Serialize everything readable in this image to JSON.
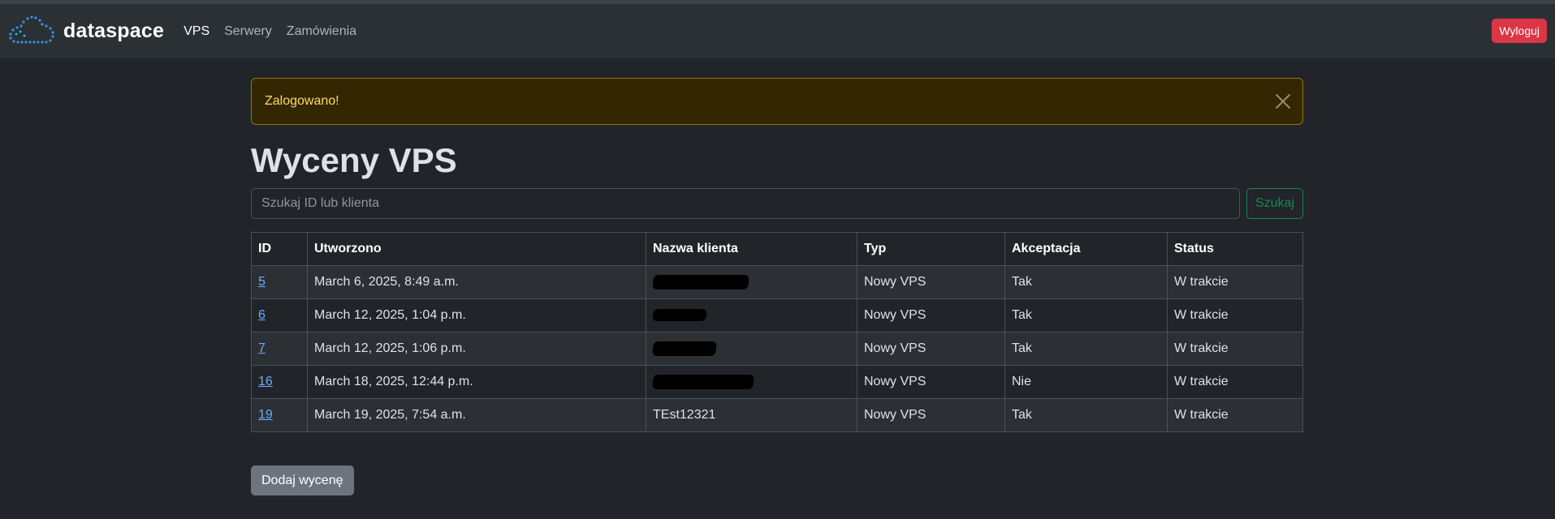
{
  "navbar": {
    "brand": "dataspace",
    "links": [
      {
        "label": "VPS",
        "active": true
      },
      {
        "label": "Serwery",
        "active": false
      },
      {
        "label": "Zamówienia",
        "active": false
      }
    ],
    "logout_label": "Wyloguj"
  },
  "alert": {
    "message": "Zalogowano!"
  },
  "page": {
    "title": "Wyceny VPS"
  },
  "search": {
    "placeholder": "Szukaj ID lub klienta",
    "button_label": "Szukaj"
  },
  "table": {
    "headers": [
      "ID",
      "Utworzono",
      "Nazwa klienta",
      "Typ",
      "Akceptacja",
      "Status"
    ],
    "rows": [
      {
        "id": "5",
        "created": "March 6, 2025, 8:49 a.m.",
        "client": "",
        "client_redacted": true,
        "type": "Nowy VPS",
        "accepted": "Tak",
        "status": "W trakcie"
      },
      {
        "id": "6",
        "created": "March 12, 2025, 1:04 p.m.",
        "client": "",
        "client_redacted": true,
        "type": "Nowy VPS",
        "accepted": "Tak",
        "status": "W trakcie"
      },
      {
        "id": "7",
        "created": "March 12, 2025, 1:06 p.m.",
        "client": "",
        "client_redacted": true,
        "type": "Nowy VPS",
        "accepted": "Tak",
        "status": "W trakcie"
      },
      {
        "id": "16",
        "created": "March 18, 2025, 12:44 p.m.",
        "client": "",
        "client_redacted": true,
        "type": "Nowy VPS",
        "accepted": "Nie",
        "status": "W trakcie"
      },
      {
        "id": "19",
        "created": "March 19, 2025, 7:54 a.m.",
        "client": "TEst12321",
        "client_redacted": false,
        "type": "Nowy VPS",
        "accepted": "Tak",
        "status": "W trakcie"
      }
    ]
  },
  "actions": {
    "add_label": "Dodaj wycenę"
  },
  "colors": {
    "background": "#212529",
    "navbar": "#2b3035",
    "alert_bg": "#332701",
    "alert_text": "#ffda6a",
    "danger": "#dc3545",
    "success": "#198754",
    "link": "#6ea8fe",
    "secondary": "#6c757d"
  },
  "icons": {
    "brand": "cloud-dots-icon",
    "alert_close": "close-icon"
  }
}
